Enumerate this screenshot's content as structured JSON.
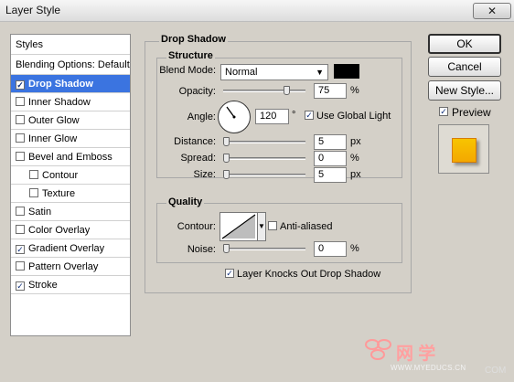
{
  "window": {
    "title": "Layer Style",
    "faded_title": "",
    "close_glyph": "✕"
  },
  "left_panel": {
    "styles_header": "Styles",
    "blending_options": "Blending Options: Default",
    "items": [
      {
        "label": "Drop Shadow",
        "checked": true,
        "selected": true
      },
      {
        "label": "Inner Shadow",
        "checked": false
      },
      {
        "label": "Outer Glow",
        "checked": false
      },
      {
        "label": "Inner Glow",
        "checked": false
      },
      {
        "label": "Bevel and Emboss",
        "checked": false
      },
      {
        "label": "Contour",
        "checked": false,
        "indent": true
      },
      {
        "label": "Texture",
        "checked": false,
        "indent": true
      },
      {
        "label": "Satin",
        "checked": false
      },
      {
        "label": "Color Overlay",
        "checked": false
      },
      {
        "label": "Gradient Overlay",
        "checked": true
      },
      {
        "label": "Pattern Overlay",
        "checked": false
      },
      {
        "label": "Stroke",
        "checked": true
      }
    ]
  },
  "drop_shadow": {
    "title": "Drop Shadow",
    "structure_title": "Structure",
    "blend_mode_label": "Blend Mode:",
    "blend_mode_value": "Normal",
    "shadow_color": "#000000",
    "opacity_label": "Opacity:",
    "opacity_value": "75",
    "opacity_unit": "%",
    "angle_label": "Angle:",
    "angle_value": "120",
    "angle_unit": "°",
    "use_global_light_label": "Use Global Light",
    "use_global_light_checked": true,
    "distance_label": "Distance:",
    "distance_value": "5",
    "distance_unit": "px",
    "spread_label": "Spread:",
    "spread_value": "0",
    "spread_unit": "%",
    "size_label": "Size:",
    "size_value": "5",
    "size_unit": "px"
  },
  "quality": {
    "title": "Quality",
    "contour_label": "Contour:",
    "anti_aliased_label": "Anti-aliased",
    "anti_aliased_checked": false,
    "noise_label": "Noise:",
    "noise_value": "0",
    "noise_unit": "%"
  },
  "layer_knocks_out_label": "Layer Knocks Out Drop Shadow",
  "layer_knocks_out_checked": true,
  "buttons": {
    "ok": "OK",
    "cancel": "Cancel",
    "new_style": "New Style...",
    "preview_label": "Preview",
    "preview_checked": true
  },
  "preview_colors": {
    "swatch_top": "#f7c400",
    "swatch_bottom": "#f4a800"
  },
  "watermark": {
    "text": "网 学",
    "url": "WWW.MYEDUCS.CN",
    "suffix": "COM"
  },
  "icons": {
    "checkbox_checked": "✓",
    "dropdown": "▼"
  }
}
